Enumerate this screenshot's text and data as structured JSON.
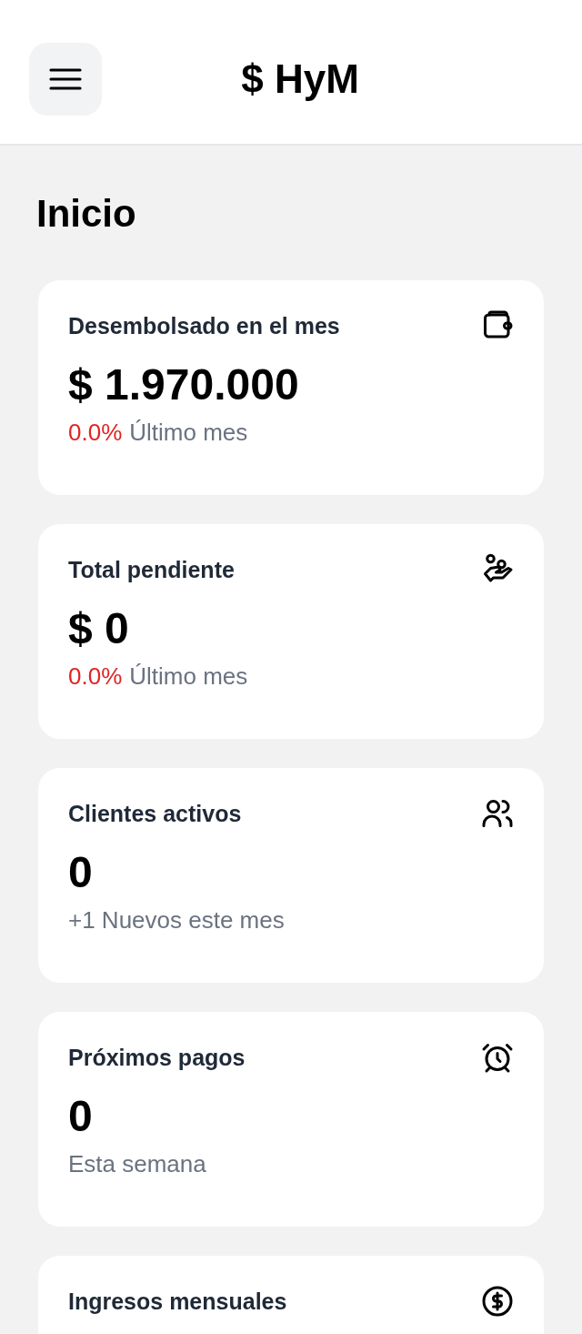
{
  "header": {
    "title": "$ HyM"
  },
  "page_title": "Inicio",
  "cards": [
    {
      "title": "Desembolsado en el mes",
      "value": "$ 1.970.000",
      "change": "0.0%",
      "note": "Último mes"
    },
    {
      "title": "Total pendiente",
      "value": "$ 0",
      "change": "0.0%",
      "note": "Último mes"
    },
    {
      "title": "Clientes activos",
      "value": "0",
      "note": "+1 Nuevos este mes"
    },
    {
      "title": "Próximos pagos",
      "value": "0",
      "note": "Esta semana"
    },
    {
      "title": "Ingresos mensuales"
    }
  ]
}
